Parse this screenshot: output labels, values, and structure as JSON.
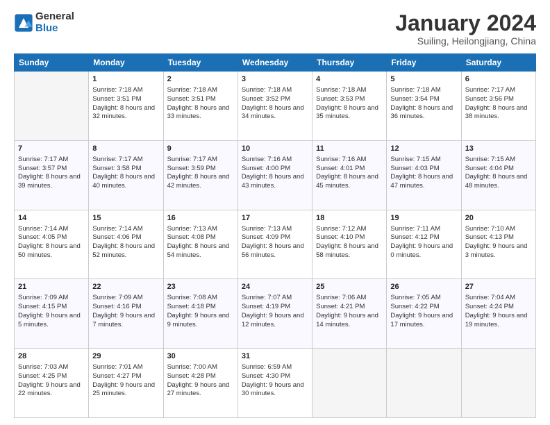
{
  "header": {
    "logo_line1": "General",
    "logo_line2": "Blue",
    "title": "January 2024",
    "subtitle": "Suiling, Heilongjiang, China"
  },
  "days_of_week": [
    "Sunday",
    "Monday",
    "Tuesday",
    "Wednesday",
    "Thursday",
    "Friday",
    "Saturday"
  ],
  "weeks": [
    [
      {
        "day": "",
        "empty": true,
        "sunrise": "",
        "sunset": "",
        "daylight": ""
      },
      {
        "day": "1",
        "empty": false,
        "sunrise": "Sunrise: 7:18 AM",
        "sunset": "Sunset: 3:51 PM",
        "daylight": "Daylight: 8 hours and 32 minutes."
      },
      {
        "day": "2",
        "empty": false,
        "sunrise": "Sunrise: 7:18 AM",
        "sunset": "Sunset: 3:51 PM",
        "daylight": "Daylight: 8 hours and 33 minutes."
      },
      {
        "day": "3",
        "empty": false,
        "sunrise": "Sunrise: 7:18 AM",
        "sunset": "Sunset: 3:52 PM",
        "daylight": "Daylight: 8 hours and 34 minutes."
      },
      {
        "day": "4",
        "empty": false,
        "sunrise": "Sunrise: 7:18 AM",
        "sunset": "Sunset: 3:53 PM",
        "daylight": "Daylight: 8 hours and 35 minutes."
      },
      {
        "day": "5",
        "empty": false,
        "sunrise": "Sunrise: 7:18 AM",
        "sunset": "Sunset: 3:54 PM",
        "daylight": "Daylight: 8 hours and 36 minutes."
      },
      {
        "day": "6",
        "empty": false,
        "sunrise": "Sunrise: 7:17 AM",
        "sunset": "Sunset: 3:56 PM",
        "daylight": "Daylight: 8 hours and 38 minutes."
      }
    ],
    [
      {
        "day": "7",
        "empty": false,
        "sunrise": "Sunrise: 7:17 AM",
        "sunset": "Sunset: 3:57 PM",
        "daylight": "Daylight: 8 hours and 39 minutes."
      },
      {
        "day": "8",
        "empty": false,
        "sunrise": "Sunrise: 7:17 AM",
        "sunset": "Sunset: 3:58 PM",
        "daylight": "Daylight: 8 hours and 40 minutes."
      },
      {
        "day": "9",
        "empty": false,
        "sunrise": "Sunrise: 7:17 AM",
        "sunset": "Sunset: 3:59 PM",
        "daylight": "Daylight: 8 hours and 42 minutes."
      },
      {
        "day": "10",
        "empty": false,
        "sunrise": "Sunrise: 7:16 AM",
        "sunset": "Sunset: 4:00 PM",
        "daylight": "Daylight: 8 hours and 43 minutes."
      },
      {
        "day": "11",
        "empty": false,
        "sunrise": "Sunrise: 7:16 AM",
        "sunset": "Sunset: 4:01 PM",
        "daylight": "Daylight: 8 hours and 45 minutes."
      },
      {
        "day": "12",
        "empty": false,
        "sunrise": "Sunrise: 7:15 AM",
        "sunset": "Sunset: 4:03 PM",
        "daylight": "Daylight: 8 hours and 47 minutes."
      },
      {
        "day": "13",
        "empty": false,
        "sunrise": "Sunrise: 7:15 AM",
        "sunset": "Sunset: 4:04 PM",
        "daylight": "Daylight: 8 hours and 48 minutes."
      }
    ],
    [
      {
        "day": "14",
        "empty": false,
        "sunrise": "Sunrise: 7:14 AM",
        "sunset": "Sunset: 4:05 PM",
        "daylight": "Daylight: 8 hours and 50 minutes."
      },
      {
        "day": "15",
        "empty": false,
        "sunrise": "Sunrise: 7:14 AM",
        "sunset": "Sunset: 4:06 PM",
        "daylight": "Daylight: 8 hours and 52 minutes."
      },
      {
        "day": "16",
        "empty": false,
        "sunrise": "Sunrise: 7:13 AM",
        "sunset": "Sunset: 4:08 PM",
        "daylight": "Daylight: 8 hours and 54 minutes."
      },
      {
        "day": "17",
        "empty": false,
        "sunrise": "Sunrise: 7:13 AM",
        "sunset": "Sunset: 4:09 PM",
        "daylight": "Daylight: 8 hours and 56 minutes."
      },
      {
        "day": "18",
        "empty": false,
        "sunrise": "Sunrise: 7:12 AM",
        "sunset": "Sunset: 4:10 PM",
        "daylight": "Daylight: 8 hours and 58 minutes."
      },
      {
        "day": "19",
        "empty": false,
        "sunrise": "Sunrise: 7:11 AM",
        "sunset": "Sunset: 4:12 PM",
        "daylight": "Daylight: 9 hours and 0 minutes."
      },
      {
        "day": "20",
        "empty": false,
        "sunrise": "Sunrise: 7:10 AM",
        "sunset": "Sunset: 4:13 PM",
        "daylight": "Daylight: 9 hours and 3 minutes."
      }
    ],
    [
      {
        "day": "21",
        "empty": false,
        "sunrise": "Sunrise: 7:09 AM",
        "sunset": "Sunset: 4:15 PM",
        "daylight": "Daylight: 9 hours and 5 minutes."
      },
      {
        "day": "22",
        "empty": false,
        "sunrise": "Sunrise: 7:09 AM",
        "sunset": "Sunset: 4:16 PM",
        "daylight": "Daylight: 9 hours and 7 minutes."
      },
      {
        "day": "23",
        "empty": false,
        "sunrise": "Sunrise: 7:08 AM",
        "sunset": "Sunset: 4:18 PM",
        "daylight": "Daylight: 9 hours and 9 minutes."
      },
      {
        "day": "24",
        "empty": false,
        "sunrise": "Sunrise: 7:07 AM",
        "sunset": "Sunset: 4:19 PM",
        "daylight": "Daylight: 9 hours and 12 minutes."
      },
      {
        "day": "25",
        "empty": false,
        "sunrise": "Sunrise: 7:06 AM",
        "sunset": "Sunset: 4:21 PM",
        "daylight": "Daylight: 9 hours and 14 minutes."
      },
      {
        "day": "26",
        "empty": false,
        "sunrise": "Sunrise: 7:05 AM",
        "sunset": "Sunset: 4:22 PM",
        "daylight": "Daylight: 9 hours and 17 minutes."
      },
      {
        "day": "27",
        "empty": false,
        "sunrise": "Sunrise: 7:04 AM",
        "sunset": "Sunset: 4:24 PM",
        "daylight": "Daylight: 9 hours and 19 minutes."
      }
    ],
    [
      {
        "day": "28",
        "empty": false,
        "sunrise": "Sunrise: 7:03 AM",
        "sunset": "Sunset: 4:25 PM",
        "daylight": "Daylight: 9 hours and 22 minutes."
      },
      {
        "day": "29",
        "empty": false,
        "sunrise": "Sunrise: 7:01 AM",
        "sunset": "Sunset: 4:27 PM",
        "daylight": "Daylight: 9 hours and 25 minutes."
      },
      {
        "day": "30",
        "empty": false,
        "sunrise": "Sunrise: 7:00 AM",
        "sunset": "Sunset: 4:28 PM",
        "daylight": "Daylight: 9 hours and 27 minutes."
      },
      {
        "day": "31",
        "empty": false,
        "sunrise": "Sunrise: 6:59 AM",
        "sunset": "Sunset: 4:30 PM",
        "daylight": "Daylight: 9 hours and 30 minutes."
      },
      {
        "day": "",
        "empty": true,
        "sunrise": "",
        "sunset": "",
        "daylight": ""
      },
      {
        "day": "",
        "empty": true,
        "sunrise": "",
        "sunset": "",
        "daylight": ""
      },
      {
        "day": "",
        "empty": true,
        "sunrise": "",
        "sunset": "",
        "daylight": ""
      }
    ]
  ]
}
